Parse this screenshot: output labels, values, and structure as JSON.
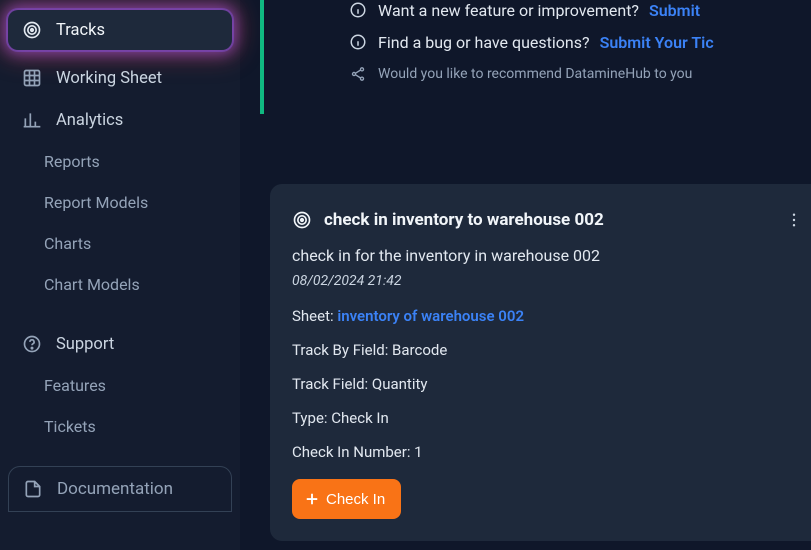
{
  "sidebar": {
    "tracks": "Tracks",
    "working_sheet": "Working Sheet",
    "analytics": "Analytics",
    "reports": "Reports",
    "report_models": "Report Models",
    "charts": "Charts",
    "chart_models": "Chart Models",
    "support": "Support",
    "features": "Features",
    "tickets": "Tickets",
    "documentation": "Documentation"
  },
  "notice": {
    "feature_q": "Want a new feature or improvement?",
    "feature_link": "Submit",
    "bug_q": "Find a bug or have questions?",
    "bug_link": "Submit Your Tic",
    "recommend_q": "Would you like to recommend DatamineHub to you"
  },
  "card": {
    "title": "check in inventory to warehouse 002",
    "desc": "check in for the inventory in warehouse 002",
    "date": "08/02/2024 21:42",
    "sheet_label": "Sheet:",
    "sheet_link": "inventory of warehouse 002",
    "track_by": "Track By Field: Barcode",
    "track_field": "Track Field: Quantity",
    "type": "Type: Check In",
    "checkin_num": "Check In Number: 1",
    "checkin_btn": "Check In"
  }
}
